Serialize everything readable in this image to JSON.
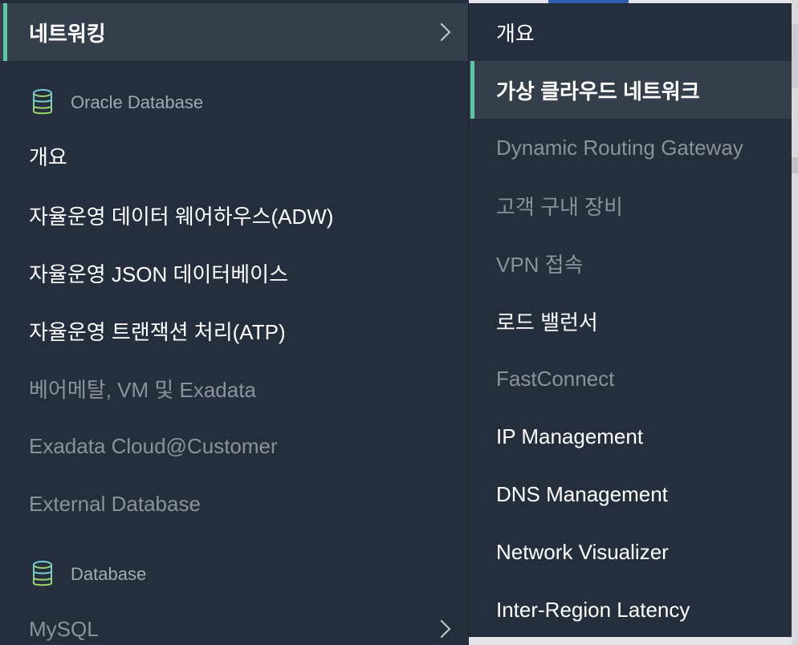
{
  "primary_menu": {
    "networking": {
      "label": "네트워킹"
    },
    "oracle_database_section": {
      "title": "Oracle Database",
      "icon": "database-icon"
    },
    "items_oracle": [
      {
        "label": "개요",
        "state": "enabled"
      },
      {
        "label": "자율운영 데이터 웨어하우스(ADW)",
        "state": "enabled"
      },
      {
        "label": "자율운영 JSON 데이터베이스",
        "state": "enabled"
      },
      {
        "label": "자율운영 트랜잭션 처리(ATP)",
        "state": "enabled"
      },
      {
        "label": "베어메탈, VM 및 Exadata",
        "state": "disabled"
      },
      {
        "label": "Exadata Cloud@Customer",
        "state": "disabled"
      },
      {
        "label": "External Database",
        "state": "disabled"
      }
    ],
    "database_section": {
      "title": "Database",
      "icon": "database-icon"
    },
    "mysql": {
      "label": "MySQL",
      "state": "disabled"
    }
  },
  "networking_submenu": {
    "items": [
      {
        "label": "개요",
        "state": "enabled"
      },
      {
        "label": "가상 클라우드 네트워크",
        "state": "active"
      },
      {
        "label": "Dynamic Routing Gateway",
        "state": "disabled"
      },
      {
        "label": "고객 구내 장비",
        "state": "disabled"
      },
      {
        "label": "VPN 접속",
        "state": "disabled"
      },
      {
        "label": "로드 밸런서",
        "state": "enabled"
      },
      {
        "label": "FastConnect",
        "state": "disabled"
      },
      {
        "label": "IP Management",
        "state": "enabled"
      },
      {
        "label": "DNS Management",
        "state": "enabled"
      },
      {
        "label": "Network Visualizer",
        "state": "enabled"
      },
      {
        "label": "Inter-Region Latency",
        "state": "enabled"
      }
    ]
  },
  "colors": {
    "menu_bg": "#252e3c",
    "active_bg": "#353e4b",
    "accent": "#5fc5a4",
    "text": "#ffffff",
    "text_disabled": "#8c929b"
  }
}
